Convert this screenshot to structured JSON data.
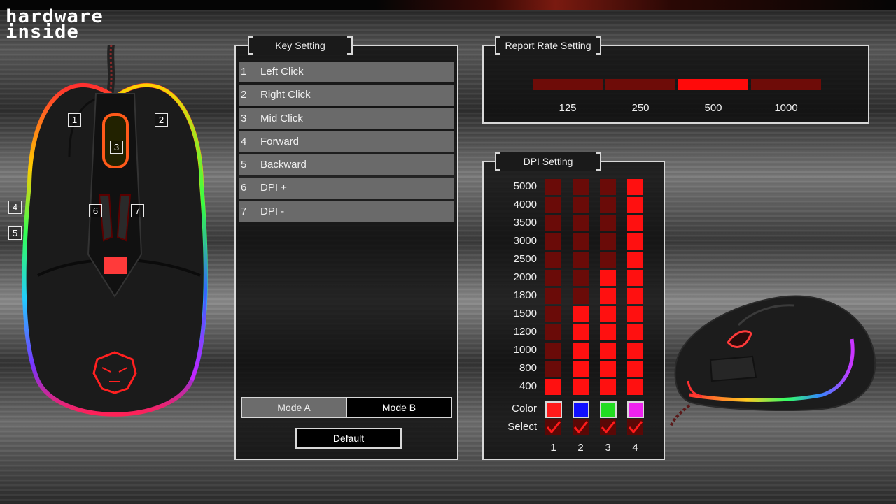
{
  "logo": {
    "line1": "hardware",
    "line2": "inside"
  },
  "mouse_callouts": [
    "1",
    "2",
    "3",
    "4",
    "5",
    "6",
    "7"
  ],
  "key_setting": {
    "title": "Key Setting",
    "items": [
      {
        "num": "1",
        "label": "Left Click"
      },
      {
        "num": "2",
        "label": "Right Click"
      },
      {
        "num": "3",
        "label": "Mid Click"
      },
      {
        "num": "4",
        "label": "Forward"
      },
      {
        "num": "5",
        "label": "Backward"
      },
      {
        "num": "6",
        "label": "DPI +"
      },
      {
        "num": "7",
        "label": "DPI -"
      }
    ],
    "mode_a": "Mode A",
    "mode_b": "Mode B",
    "selected_mode": "Mode B",
    "default_label": "Default"
  },
  "report_rate": {
    "title": "Report Rate Setting",
    "options": [
      "125",
      "250",
      "500",
      "1000"
    ],
    "selected": "500"
  },
  "dpi_setting": {
    "title": "DPI Setting",
    "levels": [
      "5000",
      "4000",
      "3500",
      "3000",
      "2500",
      "2000",
      "1800",
      "1500",
      "1200",
      "1000",
      "800",
      "400"
    ],
    "profiles": [
      {
        "num": "1",
        "selected_dpi": "400",
        "color": "#ff1a1a",
        "select": true
      },
      {
        "num": "2",
        "selected_dpi": "1500",
        "color": "#1010ff",
        "select": true
      },
      {
        "num": "3",
        "selected_dpi": "2000",
        "color": "#22dd22",
        "select": true
      },
      {
        "num": "4",
        "selected_dpi": "5000",
        "color": "#ee22ee",
        "select": true
      }
    ],
    "color_label": "Color",
    "select_label": "Select"
  },
  "colors": {
    "active_red": "#ff1010",
    "inactive_red": "#6a0b08"
  }
}
